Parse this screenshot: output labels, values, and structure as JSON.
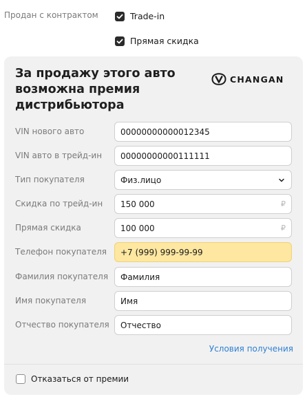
{
  "contract": {
    "label": "Продан с контрактом",
    "options": [
      {
        "label": "Trade-in",
        "checked": true
      },
      {
        "label": "Прямая скидка",
        "checked": true
      }
    ]
  },
  "card": {
    "title": "За продажу этого авто возможна премия дистрибьютора",
    "brand": "CHANGAN",
    "fields": [
      {
        "label": "VIN нового авто",
        "value": "00000000000012345",
        "suffix": ""
      },
      {
        "label": "VIN авто в трейд-ин",
        "value": "00000000000111111",
        "suffix": ""
      },
      {
        "label": "Тип покупателя",
        "value": "Физ.лицо",
        "suffix": ""
      },
      {
        "label": "Скидка по трейд-ин",
        "value": "150 000",
        "suffix": "₽"
      },
      {
        "label": "Прямая скидка",
        "value": "100 000",
        "suffix": "₽"
      },
      {
        "label": "Телефон покупателя",
        "value": "+7 (999) 999-99-99",
        "suffix": ""
      },
      {
        "label": "Фамилия покупателя",
        "value": "Фамилия",
        "suffix": ""
      },
      {
        "label": "Имя покупателя",
        "value": "Имя",
        "suffix": ""
      },
      {
        "label": "Отчество покупателя",
        "value": "Отчество",
        "suffix": ""
      }
    ],
    "conditions_link": "Условия получения",
    "refuse": {
      "label": "Отказаться от премии",
      "checked": false
    }
  },
  "colors": {
    "link": "#2f80d1",
    "highlight": "#fde7a1",
    "card_bg": "#f1f1f1"
  }
}
